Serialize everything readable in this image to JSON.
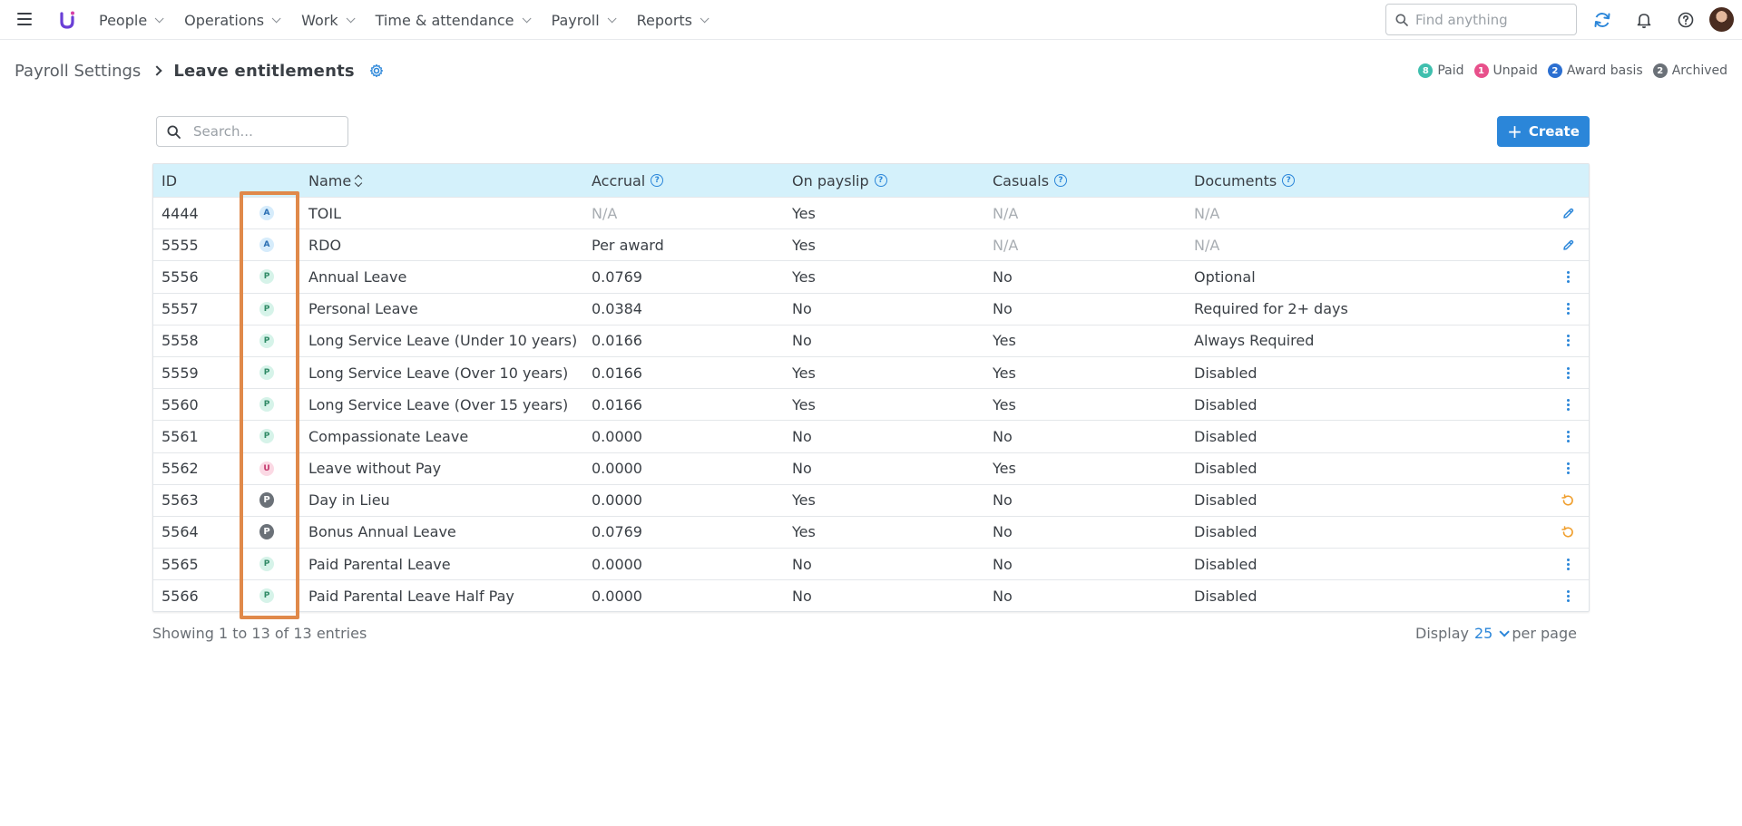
{
  "nav": {
    "items": [
      {
        "label": "People"
      },
      {
        "label": "Operations"
      },
      {
        "label": "Work"
      },
      {
        "label": "Time & attendance"
      },
      {
        "label": "Payroll"
      },
      {
        "label": "Reports"
      }
    ],
    "search_placeholder": "Find anything"
  },
  "breadcrumb": {
    "parent": "Payroll Settings",
    "current": "Leave entitlements"
  },
  "legend": [
    {
      "count": "8",
      "label": "Paid",
      "color": "#3fbfae"
    },
    {
      "count": "1",
      "label": "Unpaid",
      "color": "#e8508b"
    },
    {
      "count": "2",
      "label": "Award basis",
      "color": "#2b6fd1"
    },
    {
      "count": "2",
      "label": "Archived",
      "color": "#6b7178"
    }
  ],
  "search": {
    "placeholder": "Search..."
  },
  "create_label": "Create",
  "table": {
    "columns": {
      "id": "ID",
      "name": "Name",
      "accrual": "Accrual",
      "payslip": "On payslip",
      "casuals": "Casuals",
      "documents": "Documents"
    },
    "rows": [
      {
        "id": "4444",
        "badge": "A",
        "badge_type": "A",
        "name": "TOIL",
        "accrual": "N/A",
        "payslip": "Yes",
        "casuals": "N/A",
        "documents": "N/A",
        "action": "edit"
      },
      {
        "id": "5555",
        "badge": "A",
        "badge_type": "A",
        "name": "RDO",
        "accrual": "Per award",
        "payslip": "Yes",
        "casuals": "N/A",
        "documents": "N/A",
        "action": "edit"
      },
      {
        "id": "5556",
        "badge": "P",
        "badge_type": "P",
        "name": "Annual Leave",
        "accrual": "0.0769",
        "payslip": "Yes",
        "casuals": "No",
        "documents": "Optional",
        "action": "menu"
      },
      {
        "id": "5557",
        "badge": "P",
        "badge_type": "P",
        "name": "Personal Leave",
        "accrual": "0.0384",
        "payslip": "No",
        "casuals": "No",
        "documents": "Required for 2+ days",
        "action": "menu"
      },
      {
        "id": "5558",
        "badge": "P",
        "badge_type": "P",
        "name": "Long Service Leave (Under 10 years)",
        "accrual": "0.0166",
        "payslip": "No",
        "casuals": "Yes",
        "documents": "Always Required",
        "action": "menu"
      },
      {
        "id": "5559",
        "badge": "P",
        "badge_type": "P",
        "name": "Long Service Leave (Over 10 years)",
        "accrual": "0.0166",
        "payslip": "Yes",
        "casuals": "Yes",
        "documents": "Disabled",
        "action": "menu"
      },
      {
        "id": "5560",
        "badge": "P",
        "badge_type": "P",
        "name": "Long Service Leave (Over 15 years)",
        "accrual": "0.0166",
        "payslip": "Yes",
        "casuals": "Yes",
        "documents": "Disabled",
        "action": "menu"
      },
      {
        "id": "5561",
        "badge": "P",
        "badge_type": "P",
        "name": "Compassionate Leave",
        "accrual": "0.0000",
        "payslip": "No",
        "casuals": "No",
        "documents": "Disabled",
        "action": "menu"
      },
      {
        "id": "5562",
        "badge": "U",
        "badge_type": "U",
        "name": "Leave without Pay",
        "accrual": "0.0000",
        "payslip": "No",
        "casuals": "Yes",
        "documents": "Disabled",
        "action": "menu"
      },
      {
        "id": "5563",
        "badge": "P",
        "badge_type": "PA",
        "name": "Day in Lieu",
        "accrual": "0.0000",
        "payslip": "Yes",
        "casuals": "No",
        "documents": "Disabled",
        "action": "restore"
      },
      {
        "id": "5564",
        "badge": "P",
        "badge_type": "PA",
        "name": "Bonus Annual Leave",
        "accrual": "0.0769",
        "payslip": "Yes",
        "casuals": "No",
        "documents": "Disabled",
        "action": "restore"
      },
      {
        "id": "5565",
        "badge": "P",
        "badge_type": "P",
        "name": "Paid Parental Leave",
        "accrual": "0.0000",
        "payslip": "No",
        "casuals": "No",
        "documents": "Disabled",
        "action": "menu"
      },
      {
        "id": "5566",
        "badge": "P",
        "badge_type": "P",
        "name": "Paid Parental Leave Half Pay",
        "accrual": "0.0000",
        "payslip": "No",
        "casuals": "No",
        "documents": "Disabled",
        "action": "menu"
      }
    ]
  },
  "footer": {
    "showing": "Showing 1 to 13 of 13 entries",
    "display_label": "Display",
    "per_page_value": "25",
    "per_page_suffix": "per page"
  },
  "colors": {
    "accent": "#2b86d9",
    "header_bg": "#d4f1fb",
    "highlight": "#e0894a",
    "restore_icon": "#f0a030"
  }
}
